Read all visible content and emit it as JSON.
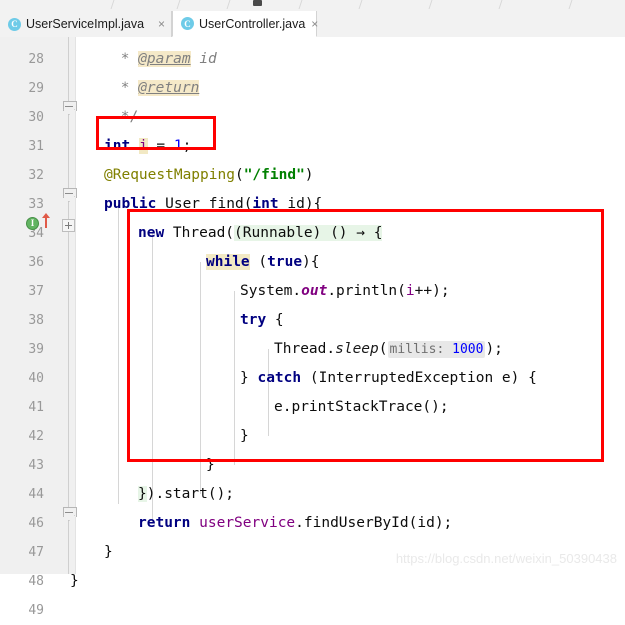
{
  "window": {
    "app": "IntelliJ IDEA code editor",
    "watermark": "https://blog.csdn.net/weixin_50390438"
  },
  "tabs": [
    {
      "label": "UserServiceImpl.java",
      "icon": "class-file-icon",
      "icon_letter": "C",
      "close": "×",
      "active": false
    },
    {
      "label": "UserController.java",
      "icon": "class-file-icon",
      "icon_letter": "C",
      "close": "×",
      "active": true
    }
  ],
  "editor": {
    "language": "Java",
    "lines": [
      {
        "num": "28",
        "tokens": [
          {
            "t": " * ",
            "c": "cmt"
          },
          {
            "t": "@param",
            "c": "jdoc-tag"
          },
          {
            "t": " ",
            "c": "jdoc-txt"
          },
          {
            "t": "id",
            "c": "jdoc-txt"
          }
        ]
      },
      {
        "num": "29",
        "tokens": [
          {
            "t": " * ",
            "c": "cmt"
          },
          {
            "t": "@return",
            "c": "jdoc-tag"
          }
        ]
      },
      {
        "num": "30",
        "tokens": [
          {
            "t": " */",
            "c": "cmt"
          }
        ]
      },
      {
        "num": "31",
        "tokens": [
          {
            "t": "int",
            "c": "kw"
          },
          {
            "t": " ",
            "c": "plain"
          },
          {
            "t": "i",
            "c": "field hl-ident"
          },
          {
            "t": " = ",
            "c": "plain"
          },
          {
            "t": "1",
            "c": "num"
          },
          {
            "t": ";",
            "c": "plain"
          }
        ]
      },
      {
        "num": "32",
        "tokens": [
          {
            "t": "@RequestMapping",
            "c": "anno"
          },
          {
            "t": "(",
            "c": "plain"
          },
          {
            "t": "\"/find\"",
            "c": "str"
          },
          {
            "t": ")",
            "c": "plain"
          }
        ]
      },
      {
        "num": "33",
        "tokens": [
          {
            "t": "public",
            "c": "kw"
          },
          {
            "t": " User find(",
            "c": "plain"
          },
          {
            "t": "int",
            "c": "kw"
          },
          {
            "t": " id){",
            "c": "plain"
          }
        ]
      },
      {
        "num": "34",
        "tokens": [
          {
            "t": "new",
            "c": "kw"
          },
          {
            "t": " Thread(",
            "c": "plain"
          },
          {
            "t": "(Runnable) () → {",
            "c": "plain hl-lambda"
          }
        ]
      },
      {
        "num": "36",
        "tokens": [
          {
            "t": "while",
            "c": "kw hl-ident"
          },
          {
            "t": " (",
            "c": "plain"
          },
          {
            "t": "true",
            "c": "kw"
          },
          {
            "t": "){",
            "c": "plain"
          }
        ]
      },
      {
        "num": "37",
        "tokens": [
          {
            "t": "System.",
            "c": "plain"
          },
          {
            "t": "out",
            "c": "static-f"
          },
          {
            "t": ".println(",
            "c": "plain"
          },
          {
            "t": "i",
            "c": "field"
          },
          {
            "t": "++);",
            "c": "plain"
          }
        ]
      },
      {
        "num": "38",
        "tokens": [
          {
            "t": "try",
            "c": "kw"
          },
          {
            "t": " {",
            "c": "plain"
          }
        ]
      },
      {
        "num": "39",
        "tokens": [
          {
            "t": "Thread.",
            "c": "plain"
          },
          {
            "t": "sleep",
            "c": "static-m"
          },
          {
            "t": "(",
            "c": "plain"
          },
          {
            "t": "millis: 1000",
            "c": "param-hint",
            "hint": true,
            "hint_name": "millis:",
            "hint_value": "1000"
          },
          {
            "t": ");",
            "c": "plain"
          }
        ]
      },
      {
        "num": "40",
        "tokens": [
          {
            "t": "} ",
            "c": "plain"
          },
          {
            "t": "catch",
            "c": "kw"
          },
          {
            "t": " (InterruptedException e) {",
            "c": "plain"
          }
        ]
      },
      {
        "num": "41",
        "tokens": [
          {
            "t": "e.printStackTrace();",
            "c": "plain"
          }
        ]
      },
      {
        "num": "42",
        "tokens": [
          {
            "t": "}",
            "c": "plain"
          }
        ]
      },
      {
        "num": "43",
        "tokens": [
          {
            "t": "}",
            "c": "plain"
          }
        ]
      },
      {
        "num": "44",
        "tokens": [
          {
            "t": "}",
            "c": "plain hl-brace"
          },
          {
            "t": ").start();",
            "c": "plain"
          }
        ]
      },
      {
        "num": "46",
        "tokens": [
          {
            "t": "return",
            "c": "kw"
          },
          {
            "t": " ",
            "c": "plain"
          },
          {
            "t": "userService",
            "c": "field"
          },
          {
            "t": ".findUserById(id);",
            "c": "plain"
          }
        ]
      },
      {
        "num": "47",
        "tokens": [
          {
            "t": "}",
            "c": "plain"
          }
        ]
      },
      {
        "num": "48",
        "tokens": [
          {
            "t": "}",
            "c": "plain"
          }
        ]
      },
      {
        "num": "49",
        "tokens": []
      }
    ],
    "gutter": {
      "impl_marker_line": "34",
      "impl_marker_letter": "I",
      "impl_marker_color": "#62b462",
      "override_arrow_color": "#e05a48",
      "fold_collapse_lines": [
        "30",
        "33",
        "47"
      ],
      "fold_expand_lines": [
        "34"
      ]
    },
    "annotations": [
      {
        "name": "highlight-box-counter-declaration",
        "color": "#ff0000"
      },
      {
        "name": "highlight-box-thread-block",
        "color": "#ff0000"
      }
    ]
  }
}
